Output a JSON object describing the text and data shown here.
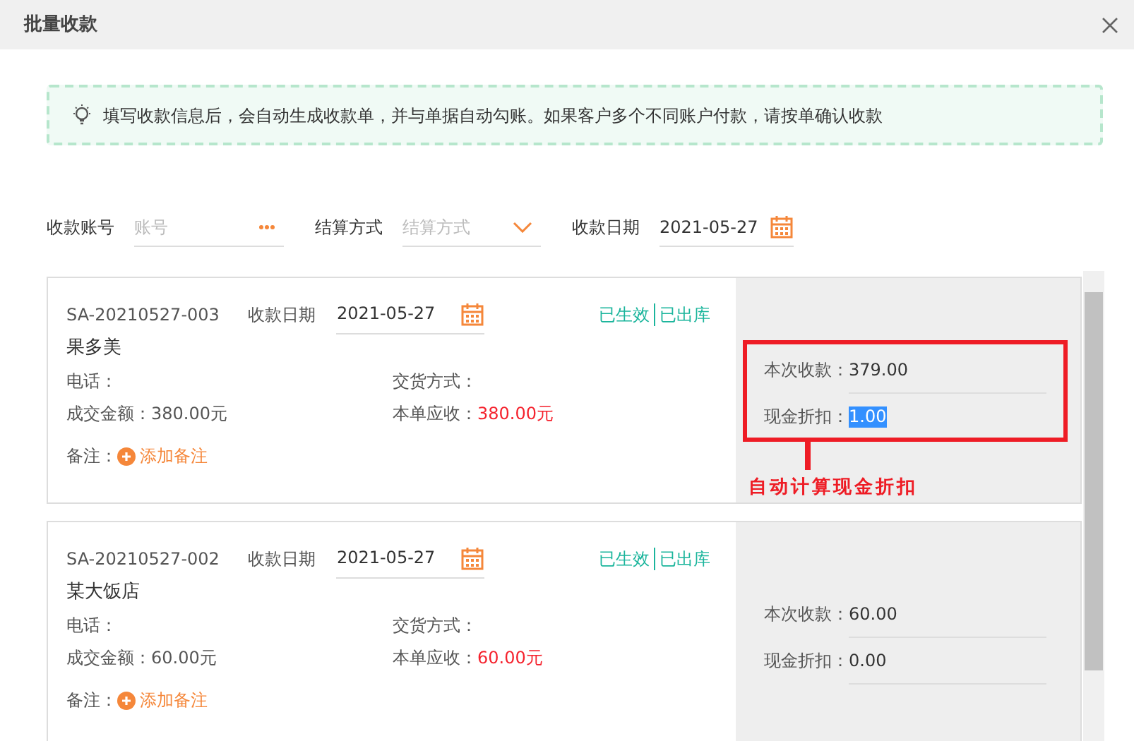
{
  "dialog": {
    "title": "批量收款"
  },
  "notice": "填写收款信息后，会自动生成收款单，并与单据自动勾账。如果客户多个不同账户付款，请按单确认收款",
  "filters": [
    {
      "kind": "more",
      "label": "收款账号",
      "placeholder": "账号"
    },
    {
      "kind": "select",
      "label": "结算方式",
      "placeholder": "结算方式"
    },
    {
      "kind": "date",
      "label": "收款日期",
      "value": "2021-05-27"
    }
  ],
  "orders": [
    {
      "order_no": "SA-20210527-003",
      "date_label": "收款日期",
      "date": "2021-05-27",
      "statuses": [
        "已生效",
        "已出库"
      ],
      "customer": "果多美",
      "phone_label": "电话：",
      "delivery_label": "交货方式：",
      "amount_label": "成交金额：",
      "amount": "380.00元",
      "receivable_label": "本单应收：",
      "receivable": "380.00元",
      "remark_label": "备注：",
      "add_remark": "添加备注",
      "payment_label": "本次收款：",
      "payment": "379.00",
      "discount_label": "现金折扣：",
      "discount": "1.00",
      "discount_selected": true,
      "annotation": "自动计算现金折扣"
    },
    {
      "order_no": "SA-20210527-002",
      "date_label": "收款日期",
      "date": "2021-05-27",
      "statuses": [
        "已生效",
        "已出库"
      ],
      "customer": "某大饭店",
      "phone_label": "电话：",
      "delivery_label": "交货方式：",
      "amount_label": "成交金额：",
      "amount": "60.00元",
      "receivable_label": "本单应收：",
      "receivable": "60.00元",
      "remark_label": "备注：",
      "add_remark": "添加备注",
      "payment_label": "本次收款：",
      "payment": "60.00",
      "discount_label": "现金折扣：",
      "discount": "0.00",
      "discount_selected": false
    }
  ]
}
